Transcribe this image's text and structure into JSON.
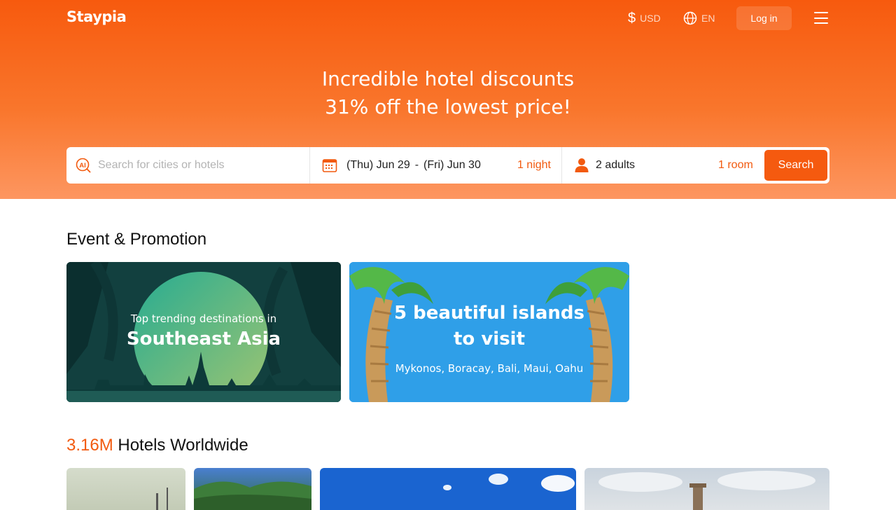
{
  "header": {
    "logo": "Staypia",
    "currency_symbol": "$",
    "currency": "USD",
    "language": "EN",
    "login_label": "Log in"
  },
  "hero": {
    "line1": "Incredible hotel discounts",
    "line2": "31% off the lowest price!"
  },
  "search": {
    "placeholder": "Search for cities or hotels",
    "check_in": "(Thu) Jun 29",
    "date_separator": "-",
    "check_out": "(Fri) Jun 30",
    "nights": "1 night",
    "guests": "2 adults",
    "rooms": "1 room",
    "button_label": "Search"
  },
  "promotions": {
    "title": "Event & Promotion",
    "cards": [
      {
        "line1": "Top trending destinations in",
        "line2": "Southeast Asia"
      },
      {
        "line1": "5 beautiful islands",
        "line2": "to visit",
        "line3": "Mykonos, Boracay, Bali, Maui, Oahu"
      }
    ]
  },
  "hotels": {
    "count": "3.16M",
    "title_rest": " Hotels Worldwide"
  },
  "colors": {
    "accent": "#f55a0f",
    "hero_top": "#f75a0e",
    "hero_bottom": "#fd9660"
  }
}
